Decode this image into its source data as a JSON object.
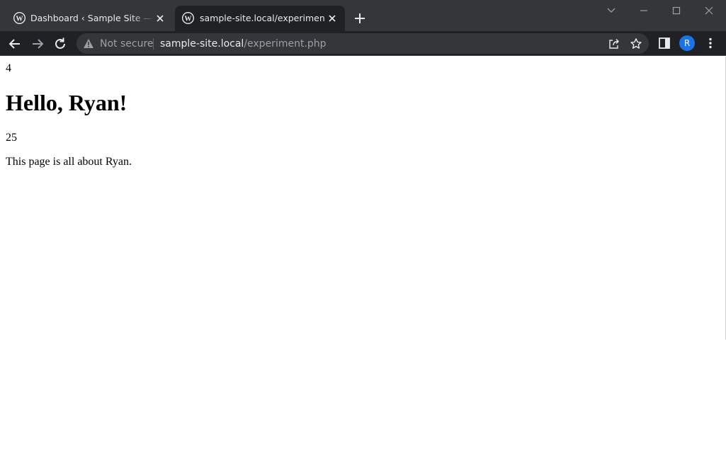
{
  "browser": {
    "tabs": [
      {
        "title": "Dashboard ‹ Sample Site — WordPress",
        "favicon": "wordpress-icon",
        "active": false
      },
      {
        "title": "sample-site.local/experiment.php",
        "favicon": "wordpress-icon",
        "active": true
      }
    ],
    "address_bar": {
      "security_label": "Not secure",
      "host": "sample-site.local",
      "path": "/experiment.php"
    },
    "profile_initial": "R",
    "colors": {
      "tabstrip": "#35363a",
      "toolbar": "#202124",
      "avatar": "#1a73e8"
    }
  },
  "page": {
    "top_number": "4",
    "heading": "Hello, Ryan!",
    "age": "25",
    "description": "This page is all about Ryan."
  }
}
